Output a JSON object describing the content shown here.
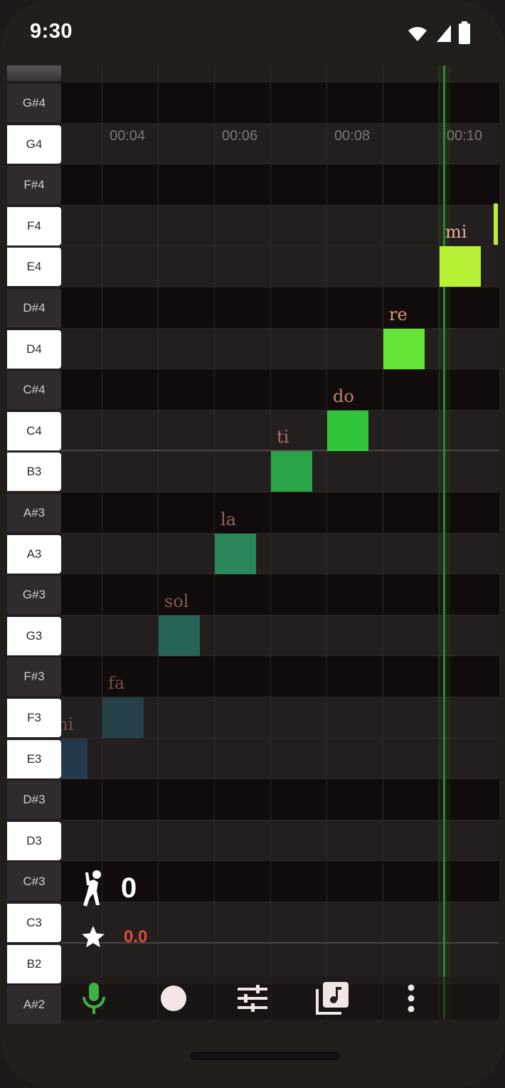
{
  "status_bar": {
    "time": "9:30"
  },
  "keys": [
    {
      "label": "G#4",
      "type": "black"
    },
    {
      "label": "G4",
      "type": "white"
    },
    {
      "label": "F#4",
      "type": "black"
    },
    {
      "label": "F4",
      "type": "white"
    },
    {
      "label": "E4",
      "type": "white"
    },
    {
      "label": "D#4",
      "type": "black"
    },
    {
      "label": "D4",
      "type": "white"
    },
    {
      "label": "C#4",
      "type": "black"
    },
    {
      "label": "C4",
      "type": "white"
    },
    {
      "label": "B3",
      "type": "white"
    },
    {
      "label": "A#3",
      "type": "black"
    },
    {
      "label": "A3",
      "type": "white"
    },
    {
      "label": "G#3",
      "type": "black"
    },
    {
      "label": "G3",
      "type": "white"
    },
    {
      "label": "F#3",
      "type": "black"
    },
    {
      "label": "F3",
      "type": "white"
    },
    {
      "label": "E3",
      "type": "white"
    },
    {
      "label": "D#3",
      "type": "black"
    },
    {
      "label": "D3",
      "type": "white"
    },
    {
      "label": "C#3",
      "type": "black"
    },
    {
      "label": "C3",
      "type": "white"
    },
    {
      "label": "B2",
      "type": "white"
    },
    {
      "label": "A#2",
      "type": "black"
    }
  ],
  "timeline": [
    "00:04",
    "00:06",
    "00:08",
    "00:10"
  ],
  "notes": [
    {
      "syllable": "mi",
      "pitch": "E3",
      "color": "#243a4c",
      "label_color": "#6e4f49"
    },
    {
      "syllable": "fa",
      "pitch": "F3",
      "color": "#254147",
      "label_color": "#6e4f49"
    },
    {
      "syllable": "sol",
      "pitch": "G3",
      "color": "#276357",
      "label_color": "#82584f"
    },
    {
      "syllable": "la",
      "pitch": "A3",
      "color": "#2a8759",
      "label_color": "#94625a"
    },
    {
      "syllable": "ti",
      "pitch": "B3",
      "color": "#2ba548",
      "label_color": "#a77063"
    },
    {
      "syllable": "do",
      "pitch": "C4",
      "color": "#2fc43a",
      "label_color": "#bf7f70"
    },
    {
      "syllable": "re",
      "pitch": "D4",
      "color": "#66e337",
      "label_color": "#d99585"
    },
    {
      "syllable": "mi",
      "pitch": "E4",
      "color": "#b8f036",
      "label_color": "#efaa98"
    }
  ],
  "score": {
    "value": "0",
    "accuracy": "0.0"
  },
  "toolbar": {
    "mic_color": "#3fb043",
    "icons": [
      "microphone-icon",
      "record-icon",
      "tune-sliders-icon",
      "music-library-icon",
      "more-vertical-icon"
    ]
  },
  "colors": {
    "c_key_marker": "#c0392b",
    "playhead": "#2c8a2a"
  }
}
